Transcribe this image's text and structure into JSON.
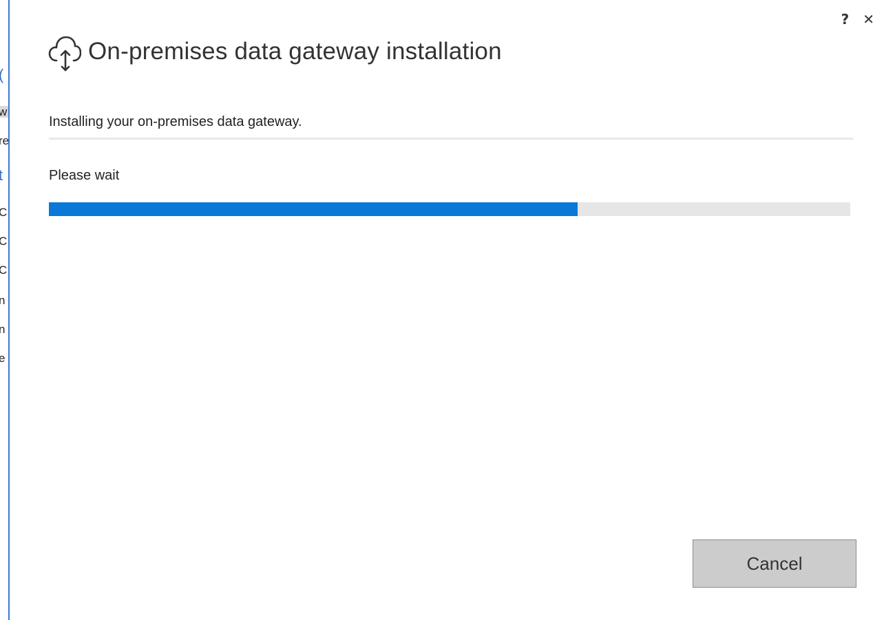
{
  "window": {
    "help_label": "?",
    "close_label": "✕",
    "title": "On-premises data gateway installation",
    "title_icon": "cloud-upload-icon"
  },
  "status": {
    "message": "Installing your on-premises data gateway.",
    "wait_label": "Please wait",
    "progress_fraction": 0.66
  },
  "actions": {
    "cancel_label": "Cancel"
  },
  "background_window": {
    "fragments": [
      "(",
      "w",
      "re",
      "t",
      "C",
      "C",
      "C",
      "n",
      "n",
      "e"
    ]
  },
  "colors": {
    "progress_fill": "#0a78d7",
    "progress_track": "#e6e6e6",
    "button_bg": "#cccccc"
  }
}
